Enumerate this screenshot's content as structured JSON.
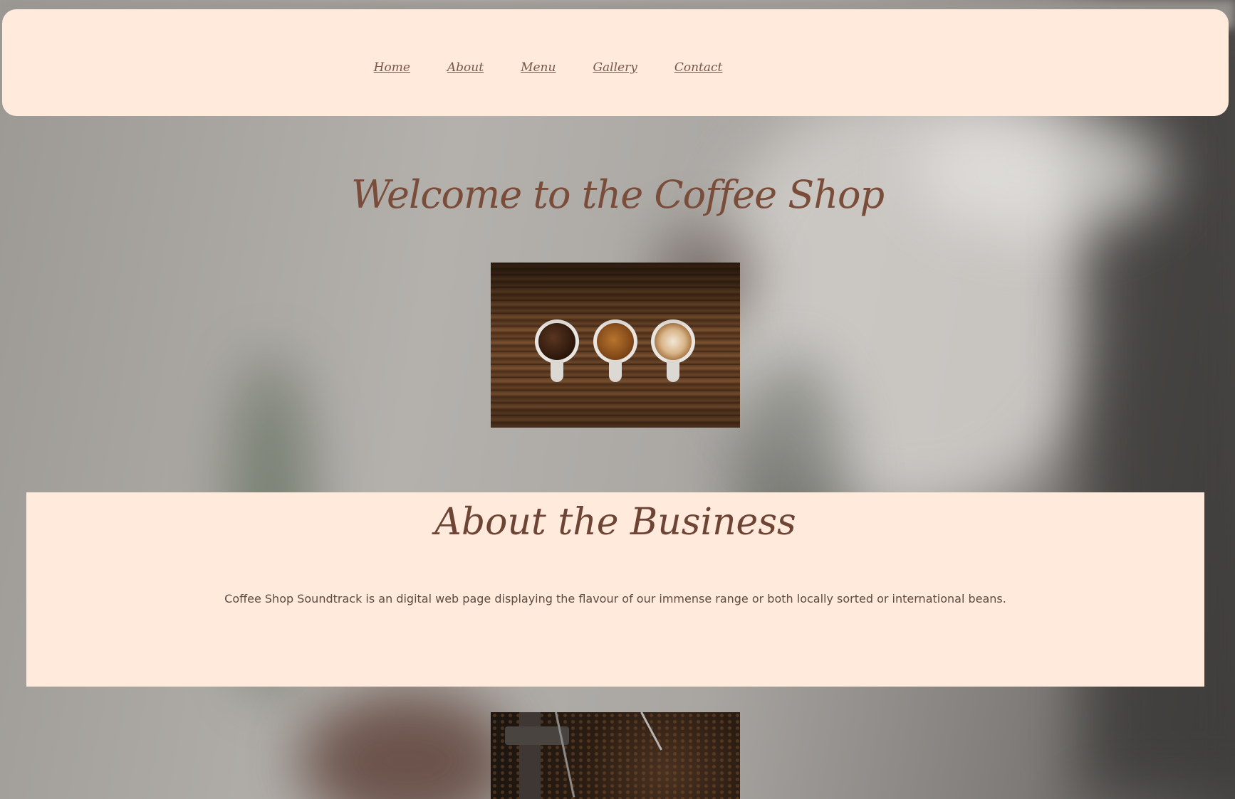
{
  "nav": {
    "items": [
      {
        "label": "Home"
      },
      {
        "label": "About"
      },
      {
        "label": "Menu"
      },
      {
        "label": "Gallery"
      },
      {
        "label": "Contact"
      }
    ]
  },
  "hero": {
    "title": "Welcome to the Coffee Shop"
  },
  "about": {
    "title": "About the Business",
    "text": "Coffee Shop Soundtrack is an digital web page displaying the flavour of our immense range or both locally sorted or international beans."
  },
  "colors": {
    "panel_bg": "#ffeadc",
    "heading": "#7a4d3a",
    "link": "#7a5647",
    "body_text": "#5f4a40"
  }
}
